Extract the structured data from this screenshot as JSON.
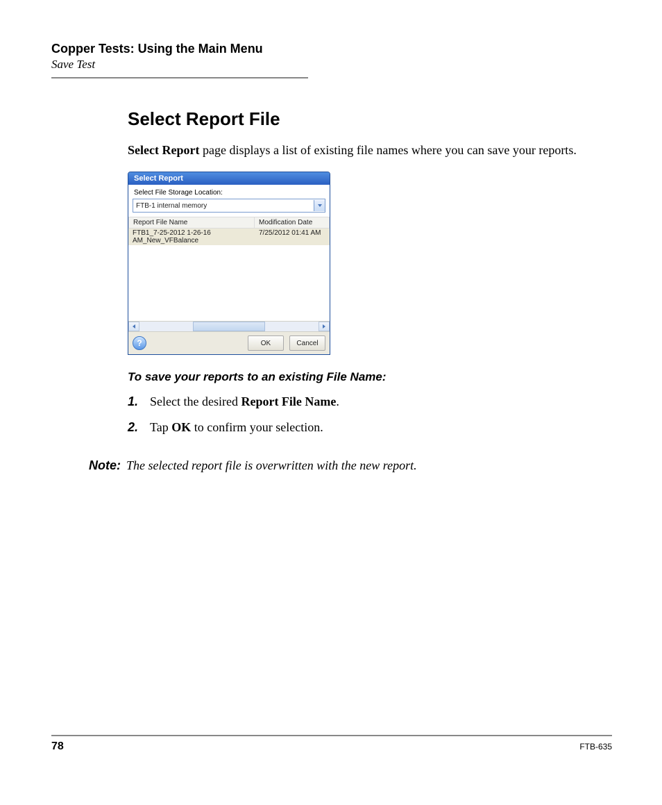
{
  "header": {
    "chapter": "Copper Tests: Using the Main Menu",
    "subchapter": "Save Test"
  },
  "section": {
    "title": "Select Report File",
    "intro_bold": "Select Report",
    "intro_rest": " page displays a list of existing file names where you can save your reports."
  },
  "dialog": {
    "title": "Select Report",
    "storage_label": "Select File Storage Location:",
    "storage_value": "FTB-1 internal memory",
    "columns": {
      "name": "Report File Name",
      "date": "Modification Date"
    },
    "rows": [
      {
        "name": "FTB1_7-25-2012 1-26-16 AM_New_VFBalance",
        "date": "7/25/2012 01:41 AM"
      }
    ],
    "ok": "OK",
    "cancel": "Cancel",
    "help": "?"
  },
  "instructions": {
    "heading": "To save your reports to an existing File Name:",
    "steps": [
      {
        "num": "1.",
        "pre": "Select the desired ",
        "bold": "Report File Name",
        "post": "."
      },
      {
        "num": "2.",
        "pre": "Tap ",
        "bold": "OK",
        "post": " to confirm your selection."
      }
    ]
  },
  "note": {
    "label": "Note:",
    "text": "The selected report file is overwritten with the new report."
  },
  "footer": {
    "page": "78",
    "model": "FTB-635"
  }
}
